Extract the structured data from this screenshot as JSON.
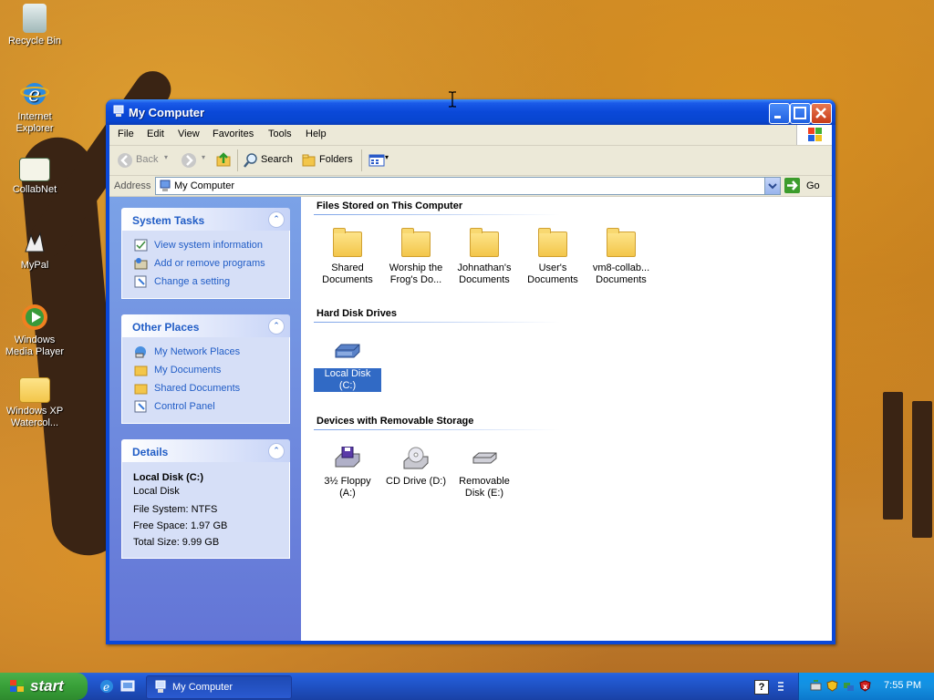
{
  "desktop": {
    "icons": [
      {
        "label": "Recycle Bin",
        "icon": "recycle-bin-icon"
      },
      {
        "label": "Internet Explorer",
        "icon": "internet-explorer-icon"
      },
      {
        "label": "CollabNet",
        "icon": "collabnet-icon"
      },
      {
        "label": "MyPal",
        "icon": "mypal-icon"
      },
      {
        "label": "Windows Media Player",
        "icon": "media-player-icon"
      },
      {
        "label": "Windows XP Watercol...",
        "icon": "zip-folder-icon"
      }
    ]
  },
  "window": {
    "title": "My Computer",
    "menu": [
      "File",
      "Edit",
      "View",
      "Favorites",
      "Tools",
      "Help"
    ],
    "toolbar": {
      "back": "Back",
      "search": "Search",
      "folders": "Folders"
    },
    "address": {
      "label": "Address",
      "value": "My Computer",
      "go": "Go"
    }
  },
  "tasks": {
    "system": {
      "title": "System Tasks",
      "items": [
        "View system information",
        "Add or remove programs",
        "Change a setting"
      ]
    },
    "other": {
      "title": "Other Places",
      "items": [
        "My Network Places",
        "My Documents",
        "Shared Documents",
        "Control Panel"
      ]
    },
    "details": {
      "title": "Details",
      "name": "Local Disk (C:)",
      "type": "Local Disk",
      "filesystem": "File System: NTFS",
      "free": "Free Space: 1.97 GB",
      "total": "Total Size: 9.99 GB"
    }
  },
  "groups": {
    "files": {
      "title": "Files Stored on This Computer",
      "items": [
        {
          "line1": "Shared",
          "line2": "Documents"
        },
        {
          "line1": "Worship the",
          "line2": "Frog's Do..."
        },
        {
          "line1": "Johnathan's",
          "line2": "Documents"
        },
        {
          "line1": "User's",
          "line2": "Documents"
        },
        {
          "line1": "vm8-collab...",
          "line2": "Documents"
        }
      ]
    },
    "hdd": {
      "title": "Hard Disk Drives",
      "items": [
        {
          "line1": "Local Disk (C:)"
        }
      ]
    },
    "removable": {
      "title": "Devices with Removable Storage",
      "items": [
        {
          "line1": "3½ Floppy",
          "line2": "(A:)"
        },
        {
          "line1": "CD Drive (D:)"
        },
        {
          "line1": "Removable",
          "line2": "Disk (E:)"
        }
      ]
    }
  },
  "taskbar": {
    "start": "start",
    "task_button": "My Computer",
    "clock": "7:55 PM",
    "help": "?"
  },
  "colors": {
    "title_blue": "#0a48d8",
    "task_link": "#215dc6",
    "start_green": "#38a038",
    "selection": "#316ac5"
  }
}
